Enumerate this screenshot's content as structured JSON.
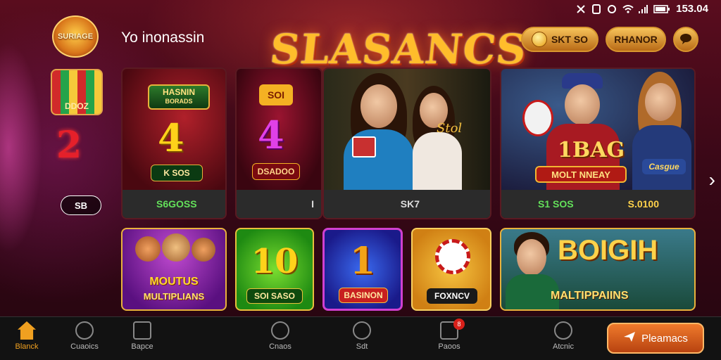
{
  "status_bar": {
    "time": "153.04"
  },
  "sidebar": {
    "logo_text": "SURIAGE",
    "slot_text": "DDOZ",
    "big_number": "2",
    "pill_text": "SB"
  },
  "header": {
    "title": "Yo inonassin",
    "logo": "SLASANCS",
    "coin_button": "SKT SO",
    "rank_button": "RHANOR"
  },
  "cards": [
    {
      "banner": "HASNIN",
      "banner_sub": "BORADS",
      "number": "4",
      "plate": "K SOS",
      "footer": "S6GOSS"
    },
    {
      "banner": "SOI",
      "number": "4",
      "plate": "DSADOO",
      "footer": "I"
    },
    {
      "script": "Stol",
      "footer": "SK7"
    },
    {
      "title_num": "1BAG",
      "banner": "MOLT NNEAY",
      "sign": "Casgue",
      "footer_left": "S1 SOS",
      "footer_right": "S.0100"
    }
  ],
  "tiles": [
    {
      "label1": "MOUTUS",
      "label2": "MULTIPLIANS"
    },
    {
      "number": "10",
      "plate": "SOI SASO"
    },
    {
      "number": "1",
      "plate": "BASINON"
    },
    {
      "plate": "FOXNCV"
    },
    {
      "title": "BOIGIH",
      "subtitle": "MALTIPPAIINS"
    }
  ],
  "bottom_nav": [
    {
      "label": "Blanck",
      "icon": "home-icon"
    },
    {
      "label": "Cuaoics",
      "icon": "heart-icon"
    },
    {
      "label": "Bapce",
      "icon": "bag-icon"
    },
    {
      "label": "Cnaos",
      "icon": "chip-icon"
    },
    {
      "label": "Sdt",
      "icon": "coins-icon"
    },
    {
      "label": "Paoos",
      "icon": "briefcase-icon",
      "badge": "8"
    },
    {
      "label": "Atcnic",
      "icon": "compass-icon"
    }
  ],
  "action_button": "Pleamacs"
}
